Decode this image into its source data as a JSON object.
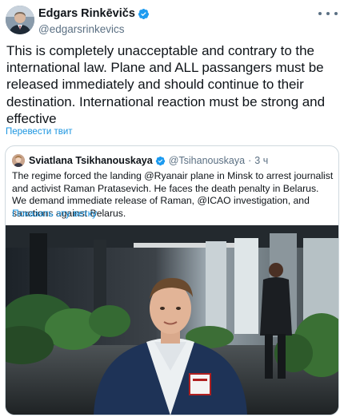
{
  "tweet": {
    "author_name": "Edgars Rinkēvičs",
    "author_handle": "@edgarsrinkevics",
    "text": "This is completely unacceptable and contrary to the international law. Plane and ALL passangers must be released immediately and should continue to their destination. International reaction must be strong and effective",
    "translate_label": "Перевести твит",
    "more_icon": "more-horizontal-icon",
    "verified_icon": "verified-badge-icon"
  },
  "quote": {
    "author_name": "Sviatlana Tsikhanouskaya",
    "author_handle": "@Tsihanouskaya",
    "separator": "·",
    "time": "3 ч",
    "text": "The regime forced the landing @Ryanair plane in Minsk to arrest journalist and activist Raman Pratasevich. He faces the death penalty in Belarus. We demand immediate release of Raman, @ICAO investigation, and sanctions against Belarus.",
    "show_thread_label": "Показать эту ветку"
  },
  "colors": {
    "link": "#1b95e0",
    "verified": "#1d9bf0",
    "secondary_text": "#5b7083",
    "border": "#cfd9de"
  }
}
